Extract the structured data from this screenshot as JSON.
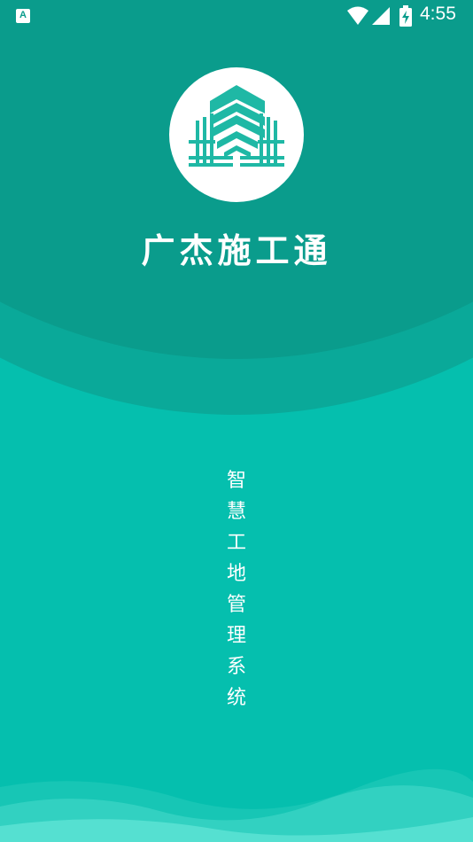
{
  "status_bar": {
    "time": "4:55",
    "notification_icon": "a-icon",
    "icons": [
      "wifi-icon",
      "signal-icon",
      "battery-charging-icon"
    ]
  },
  "app": {
    "logo_icon": "building-icon",
    "title": "广杰施工通",
    "slogan": "智慧工地管理系统"
  },
  "colors": {
    "background": "#05bfae",
    "arc_outer": "#0aa999",
    "arc_inner": "#0a9c8c",
    "logo_bg": "#ffffff",
    "logo_fg": "#1fb8a5",
    "text": "#ffffff"
  }
}
